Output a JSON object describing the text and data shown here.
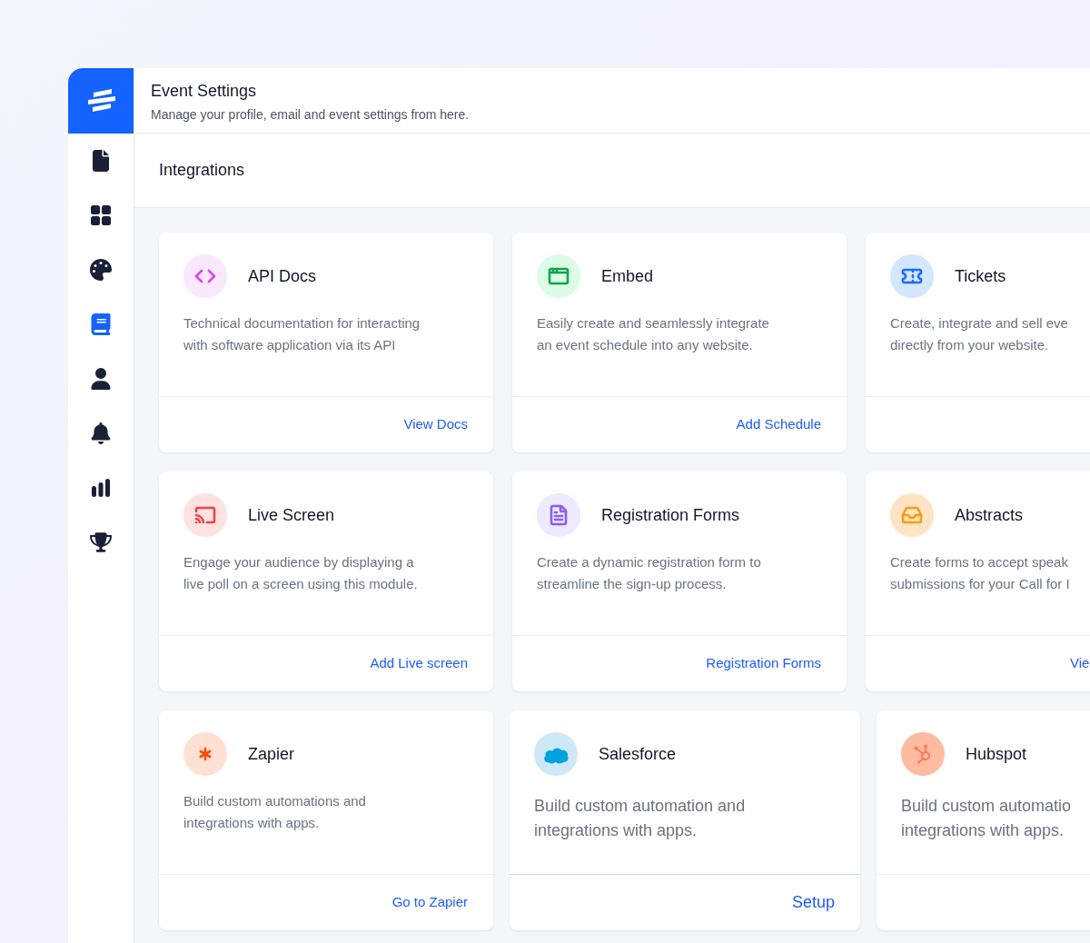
{
  "header": {
    "title": "Event Settings",
    "subtitle": "Manage your profile, email and event settings from here."
  },
  "sidebar": {
    "items": [
      {
        "selected": false
      },
      {
        "selected": false
      },
      {
        "selected": false
      },
      {
        "selected": true
      },
      {
        "selected": false
      },
      {
        "selected": false
      },
      {
        "selected": false
      },
      {
        "selected": false
      }
    ]
  },
  "section": {
    "title": "Integrations"
  },
  "rows": [
    [
      {
        "title": "API Docs",
        "description": "Technical documentation for interacting with software application via its API",
        "action": "View Docs",
        "color": "#d946ef"
      },
      {
        "title": "Embed",
        "description": "Easily create and seamlessly integrate an event schedule into any website.",
        "action": "Add Schedule",
        "color": "#16a34a"
      },
      {
        "title": "Tickets",
        "description": "Create, integrate and sell eve\ndirectly from your website.",
        "color": "#1a6bff"
      }
    ],
    [
      {
        "title": "Live Screen",
        "description": "Engage your audience by displaying a live poll on a screen using this module.",
        "action": "Add Live screen",
        "color": "#f04444"
      },
      {
        "title": "Registration Forms",
        "description": "Create a dynamic registration form to streamline the sign-up process.",
        "action": "Registration Forms",
        "color": "#8b5cf6"
      },
      {
        "title": "Abstracts",
        "description": "Create forms to accept speak\nsubmissions for your Call for I",
        "action": "Vie",
        "color": "#f59e0b"
      }
    ],
    [
      {
        "title": "Zapier",
        "description": "Build custom automations and integrations with apps.",
        "action": "Go to Zapier",
        "color": "#ff4a00"
      },
      {
        "title": "Salesforce",
        "description": "Build custom automation and integrations with apps.",
        "action": "Setup",
        "color": "#00a1e0"
      },
      {
        "title": "Hubspot",
        "description": "Build custom automatio\nintegrations with apps.",
        "color": "#ff7a59"
      }
    ]
  ]
}
